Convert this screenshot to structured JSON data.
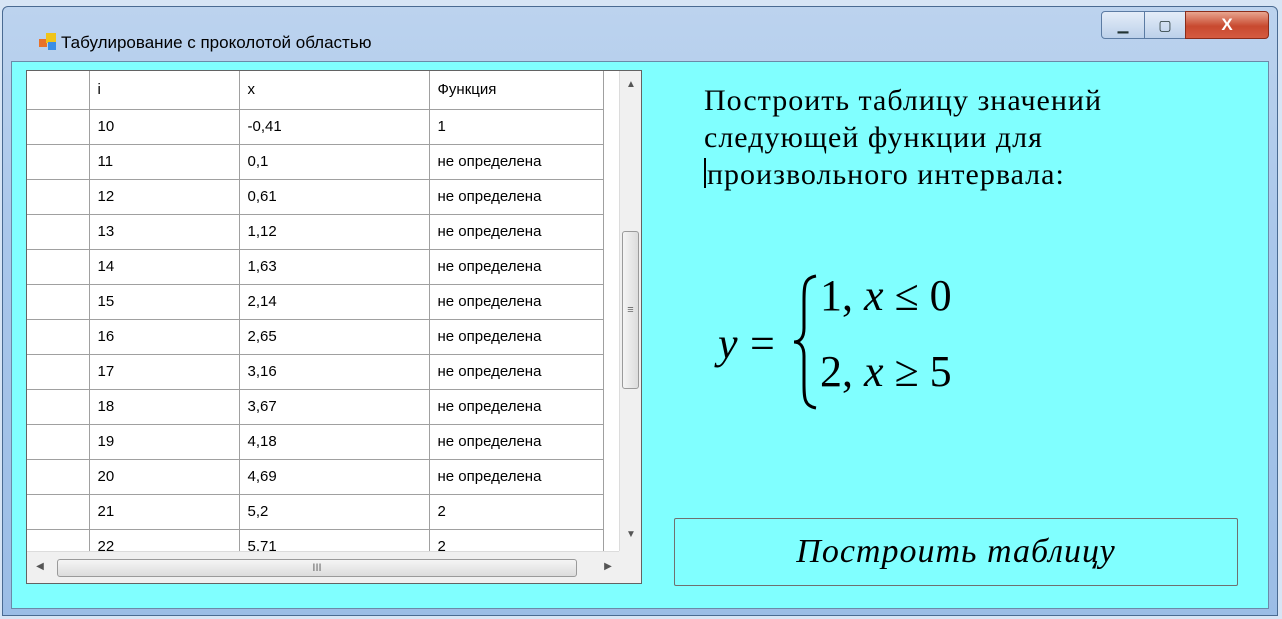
{
  "window": {
    "title": "Табулирование с проколотой областью",
    "minimize_glyph": "▁",
    "maximize_glyph": "▢",
    "close_glyph": "X"
  },
  "grid": {
    "columns": [
      "i",
      "x",
      "Функция"
    ],
    "rows": [
      {
        "i": "10",
        "x": "-0,41",
        "f": "1"
      },
      {
        "i": "11",
        "x": "0,1",
        "f": "не определена"
      },
      {
        "i": "12",
        "x": "0,61",
        "f": "не определена"
      },
      {
        "i": "13",
        "x": "1,12",
        "f": "не определена"
      },
      {
        "i": "14",
        "x": "1,63",
        "f": "не определена"
      },
      {
        "i": "15",
        "x": "2,14",
        "f": "не определена"
      },
      {
        "i": "16",
        "x": "2,65",
        "f": "не определена"
      },
      {
        "i": "17",
        "x": "3,16",
        "f": "не определена"
      },
      {
        "i": "18",
        "x": "3,67",
        "f": "не определена"
      },
      {
        "i": "19",
        "x": "4,18",
        "f": "не определена"
      },
      {
        "i": "20",
        "x": "4,69",
        "f": "не определена"
      },
      {
        "i": "21",
        "x": "5,2",
        "f": "2"
      },
      {
        "i": "22",
        "x": "5,71",
        "f": "2"
      }
    ],
    "scroll_up_glyph": "▲",
    "scroll_down_glyph": "▼",
    "scroll_left_glyph": "◀",
    "scroll_right_glyph": "▶",
    "vthumb_grip": "≡",
    "hthumb_grip": "III"
  },
  "task": {
    "line1": "Построить таблицу значений",
    "line2": "следующей функции для",
    "line3": "произвольного интервала:"
  },
  "formula": {
    "lhs": "y",
    "eq": "=",
    "case1_val": "1,",
    "case1_var": "x",
    "case1_cond": " ≤ 0",
    "case2_val": "2,",
    "case2_var": "x",
    "case2_cond": " ≥ 5"
  },
  "build_button": {
    "label": "Построить таблицу"
  },
  "colors": {
    "client_bg": "#80ffff",
    "title_bar": "#a9c6ea",
    "close_button": "#c8492f"
  }
}
